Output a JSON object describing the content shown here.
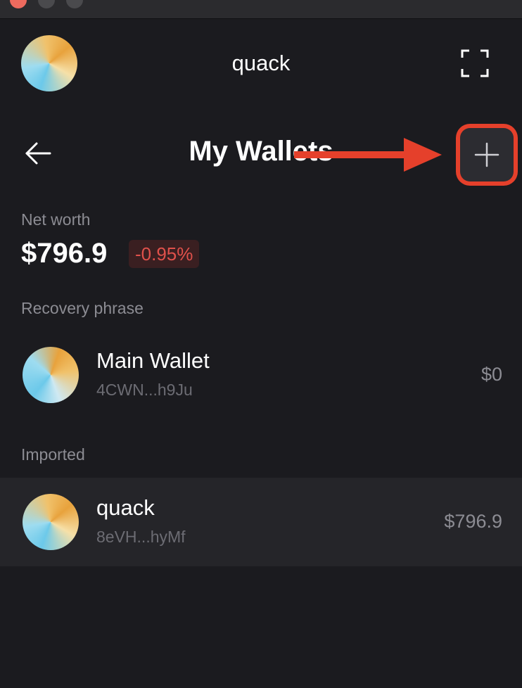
{
  "header": {
    "account_name": "quack"
  },
  "page": {
    "title": "My Wallets"
  },
  "net_worth": {
    "label": "Net worth",
    "value": "$796.9",
    "change": "-0.95%"
  },
  "sections": {
    "recovery_label": "Recovery phrase",
    "imported_label": "Imported"
  },
  "wallets": [
    {
      "name": "Main Wallet",
      "address": "4CWN...h9Ju",
      "balance": "$0"
    },
    {
      "name": "quack",
      "address": "8eVH...hyMf",
      "balance": "$796.9"
    }
  ],
  "icons": {
    "back": "arrow-left-icon",
    "scan": "scan-icon",
    "add": "plus-icon",
    "annotation": "red-arrow-icon"
  },
  "colors": {
    "background": "#1b1b1f",
    "highlight": "#e5402b",
    "negative": "#e0514b",
    "selected_row": "#252529"
  }
}
